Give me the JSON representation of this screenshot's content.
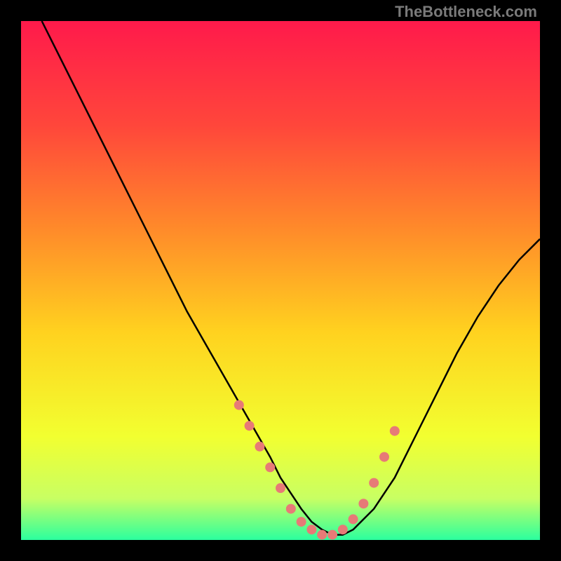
{
  "attribution": "TheBottleneck.com",
  "chart_data": {
    "type": "line",
    "title": "",
    "xlabel": "",
    "ylabel": "",
    "xlim": [
      0,
      100
    ],
    "ylim": [
      0,
      100
    ],
    "background_gradient": {
      "stops": [
        {
          "offset": 0.0,
          "color": "#ff1a4b"
        },
        {
          "offset": 0.2,
          "color": "#ff463b"
        },
        {
          "offset": 0.4,
          "color": "#ff8a2a"
        },
        {
          "offset": 0.6,
          "color": "#ffd21f"
        },
        {
          "offset": 0.8,
          "color": "#f2ff30"
        },
        {
          "offset": 0.92,
          "color": "#c8ff63"
        },
        {
          "offset": 1.0,
          "color": "#2bff9e"
        }
      ]
    },
    "series": [
      {
        "name": "curve",
        "color": "#000000",
        "x": [
          4,
          8,
          12,
          16,
          20,
          24,
          28,
          32,
          36,
          40,
          44,
          48,
          50,
          52,
          54,
          56,
          58,
          60,
          62,
          64,
          68,
          72,
          76,
          80,
          84,
          88,
          92,
          96,
          100
        ],
        "y": [
          100,
          92,
          84,
          76,
          68,
          60,
          52,
          44,
          37,
          30,
          23,
          16,
          12,
          9,
          6,
          3.5,
          2,
          1,
          1,
          2,
          6,
          12,
          20,
          28,
          36,
          43,
          49,
          54,
          58
        ]
      }
    ],
    "markers": {
      "name": "highlight-dots",
      "color": "#e77a77",
      "radius": 7,
      "points": [
        {
          "x": 42,
          "y": 26
        },
        {
          "x": 44,
          "y": 22
        },
        {
          "x": 46,
          "y": 18
        },
        {
          "x": 48,
          "y": 14
        },
        {
          "x": 50,
          "y": 10
        },
        {
          "x": 52,
          "y": 6
        },
        {
          "x": 54,
          "y": 3.5
        },
        {
          "x": 56,
          "y": 2
        },
        {
          "x": 58,
          "y": 1
        },
        {
          "x": 60,
          "y": 1
        },
        {
          "x": 62,
          "y": 2
        },
        {
          "x": 64,
          "y": 4
        },
        {
          "x": 66,
          "y": 7
        },
        {
          "x": 68,
          "y": 11
        },
        {
          "x": 70,
          "y": 16
        },
        {
          "x": 72,
          "y": 21
        }
      ]
    }
  }
}
